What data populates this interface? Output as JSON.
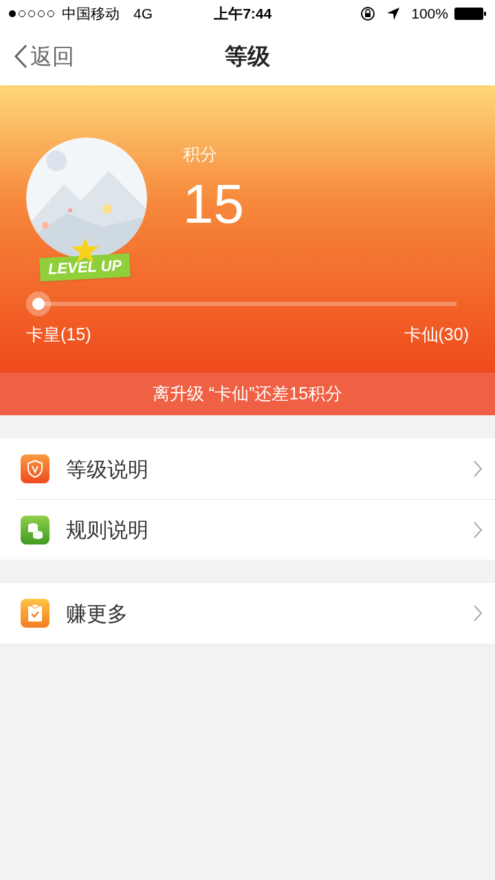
{
  "status_bar": {
    "carrier": "中国移动",
    "network": "4G",
    "time": "上午7:44",
    "battery": "100%"
  },
  "nav": {
    "back": "返回",
    "title": "等级"
  },
  "header": {
    "badge": "LEVEL UP",
    "points_label": "积分",
    "points": "15",
    "progress": {
      "level": 0.0,
      "from": "卡皇(15)",
      "to": "卡仙(30)"
    },
    "notice": "离升级 “卡仙”还差15积分"
  },
  "groups": [
    {
      "items": [
        {
          "kind": "shield",
          "label": "等级说明"
        },
        {
          "kind": "coins",
          "label": "规则说明"
        }
      ]
    },
    {
      "items": [
        {
          "kind": "clipboard",
          "label": "赚更多"
        }
      ]
    }
  ]
}
